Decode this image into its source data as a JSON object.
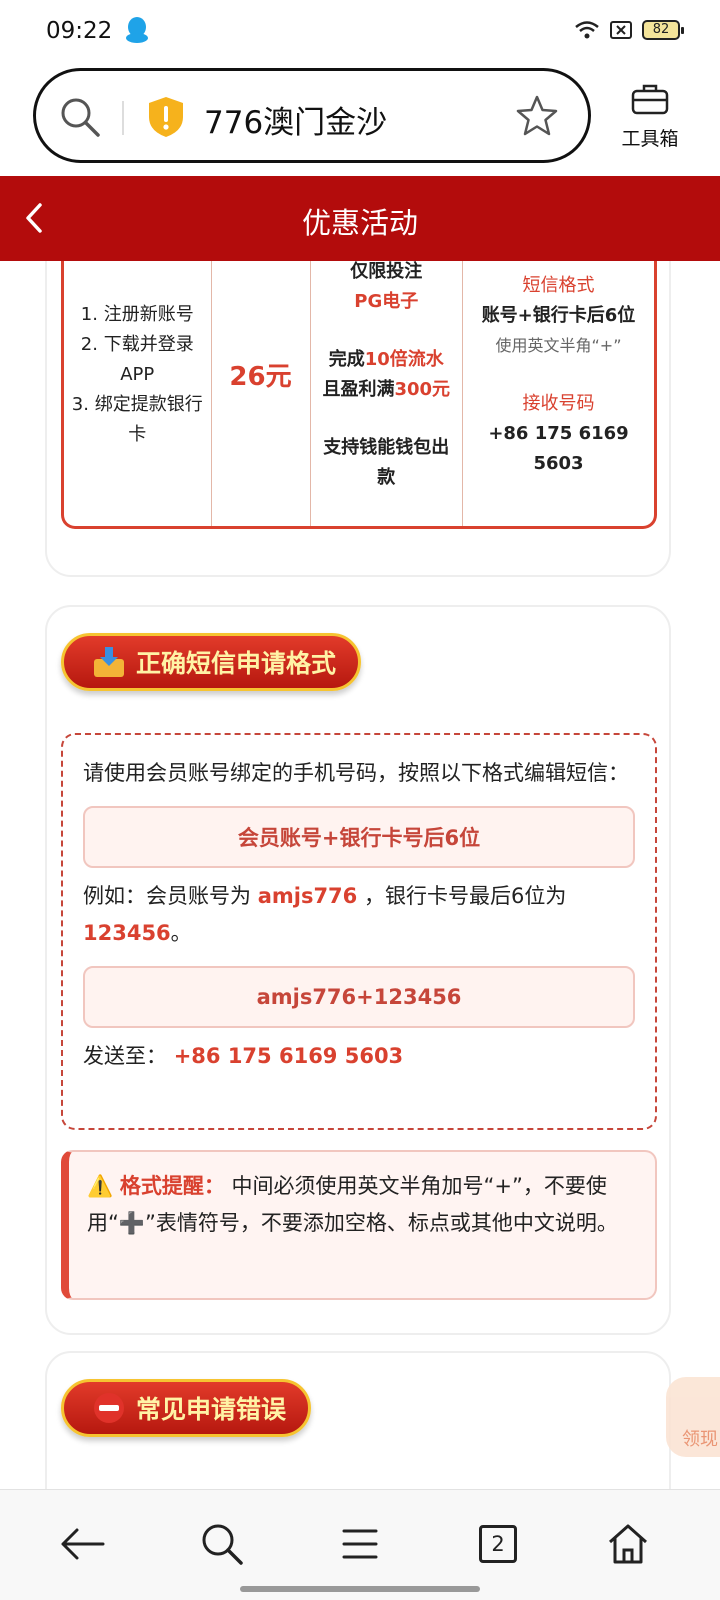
{
  "status": {
    "time": "09:22",
    "battery": "82"
  },
  "search": {
    "text": "776澳门金沙",
    "toolbox_label": "工具箱"
  },
  "header": {
    "title": "优惠活动"
  },
  "rule_table": {
    "steps": [
      "1. 注册新账号",
      "2. 下载并登录APP",
      "3. 绑定提款银行卡"
    ],
    "amount": "26元",
    "condition_line1": "仅限投注",
    "condition_pg": "PG电子",
    "condition_prefix": "完成",
    "condition_times": "10倍流水",
    "condition_mid": "且盈利满",
    "condition_profit": "300元",
    "condition_wallet": "支持钱能钱包出款",
    "sms_format_title": "短信格式",
    "sms_format_value": "账号+银行卡后6位",
    "sms_format_note": "使用英文半角“+”",
    "receive_title": "接收号码",
    "receive_number": "+86 175 6169 5603"
  },
  "sms_section": {
    "title": "正确短信申请格式",
    "intro": "请使用会员账号绑定的手机号码，按照以下格式编辑短信：",
    "format": "会员账号+银行卡号后6位",
    "example_prefix": "例如：会员账号为",
    "example_account": "amjs776",
    "example_mid": "，银行卡号最后6位为",
    "example_digits": "123456",
    "example_end": "。",
    "example_sms": "amjs776+123456",
    "sendto_label": "发送至：",
    "sendto_number": "+86 175 6169 5603"
  },
  "notice": {
    "label": "格式提醒：",
    "text": "中间必须使用英文半角加号“+”，不要使用“➕”表情符号，不要添加空格、标点或其他中文说明。"
  },
  "errors_section": {
    "title": "常见申请错误"
  },
  "floating": {
    "label": "领现"
  },
  "nav": {
    "tabs_count": "2"
  }
}
